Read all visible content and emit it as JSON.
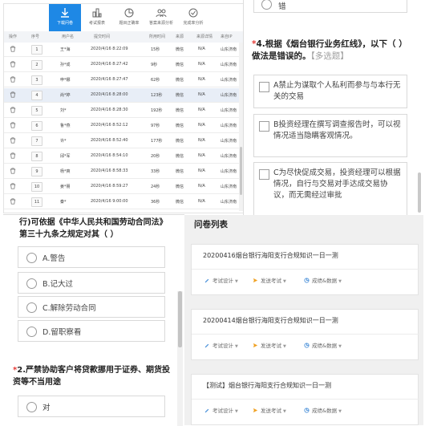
{
  "table_panel": {
    "toolbar": [
      {
        "label": "下载问卷",
        "icon": "download-icon",
        "active": true
      },
      {
        "label": "考试报表",
        "icon": "report-icon",
        "active": false
      },
      {
        "label": "题目正确率",
        "icon": "pie-chart-icon",
        "active": false
      },
      {
        "label": "答案来源分析",
        "icon": "group-icon",
        "active": false
      },
      {
        "label": "完成率分析",
        "icon": "check-circle-icon",
        "active": false
      }
    ],
    "columns": [
      "操作",
      "序号",
      "用户名",
      "提交时间",
      "所用时间",
      "来源",
      "来源详情",
      "来自IP"
    ],
    "rows": [
      {
        "no": "1",
        "user": "王*海",
        "time": "2020/4/16 8:22:09",
        "dur": "15秒",
        "src": "微信",
        "detail": "N/A",
        "ip": "山东济南"
      },
      {
        "no": "2",
        "user": "孙*成",
        "time": "2020/4/16 8:27:42",
        "dur": "9秒",
        "src": "微信",
        "detail": "N/A",
        "ip": "山东济南"
      },
      {
        "no": "3",
        "user": "申*娜",
        "time": "2020/4/16 8:27:47",
        "dur": "62秒",
        "src": "微信",
        "detail": "N/A",
        "ip": "山东济南"
      },
      {
        "no": "4",
        "user": "尚*婷",
        "time": "2020/4/16 8:28:00",
        "dur": "123秒",
        "src": "微信",
        "detail": "N/A",
        "ip": "山东济南"
      },
      {
        "no": "5",
        "user": "刘*",
        "time": "2020/4/16 8:28:30",
        "dur": "192秒",
        "src": "微信",
        "detail": "N/A",
        "ip": "山东济南"
      },
      {
        "no": "6",
        "user": "鲁*燕",
        "time": "2020/4/16 8:52:12",
        "dur": "97秒",
        "src": "微信",
        "detail": "N/A",
        "ip": "山东济南"
      },
      {
        "no": "7",
        "user": "许*",
        "time": "2020/4/16 8:52:40",
        "dur": "177秒",
        "src": "微信",
        "detail": "N/A",
        "ip": "山东济南"
      },
      {
        "no": "8",
        "user": "邱*军",
        "time": "2020/4/16 8:54:10",
        "dur": "20秒",
        "src": "微信",
        "detail": "N/A",
        "ip": "山东济南"
      },
      {
        "no": "9",
        "user": "杨*爽",
        "time": "2020/4/16 8:58:33",
        "dur": "33秒",
        "src": "微信",
        "detail": "N/A",
        "ip": "山东济南"
      },
      {
        "no": "10",
        "user": "姜*朋",
        "time": "2020/4/16 8:59:27",
        "dur": "24秒",
        "src": "微信",
        "detail": "N/A",
        "ip": "山东济南"
      },
      {
        "no": "11",
        "user": "秦*",
        "time": "2020/4/16 9:00:00",
        "dur": "36秒",
        "src": "微信",
        "detail": "N/A",
        "ip": "山东济南"
      }
    ],
    "accent": "#1e88e5",
    "highlight_row": "#e8eef7"
  },
  "question4_panel": {
    "prev_option_tail": "错",
    "required_mark": "*",
    "title": "4.根据《烟台银行业务红线》，以下（ ）做法是错误的。",
    "type_tag": "【多选题】",
    "options": [
      "A禁止为谋取个人私利而参与与本行无关的交易",
      "B投资经理在撰写调查报告时，可以视情况适当隐瞒客观情况。",
      "C为尽快促成交易，投资经理可以根据情况，自行与交易对手达成交易协议，而无需经过审批"
    ],
    "required_color": "#e53935"
  },
  "question1_panel": {
    "question_text": "行)可依据《中华人民共和国劳动合同法》第三十九条之规定对其（ ）",
    "options": [
      "A.警告",
      "B.记大过",
      "C.解除劳动合同",
      "D.留职察看"
    ],
    "question2": {
      "required_mark": "*",
      "title": "2.严禁协助客户将贷款挪用于证券、期货投资等不当用途",
      "options": [
        "对"
      ]
    }
  },
  "list_panel": {
    "heading": "问卷列表",
    "cards": [
      {
        "name": "20200416烟台银行海阳支行合规知识一日一测"
      },
      {
        "name": "20200414烟台银行海阳支行合规知识一日一测"
      },
      {
        "name": "【测试】烟台银行海阳支行合规知识一日一测"
      }
    ],
    "actions": [
      {
        "label": "考试设计",
        "icon": "pencil-icon"
      },
      {
        "label": "发送考试",
        "icon": "send-icon"
      },
      {
        "label": "成绩&数据",
        "icon": "data-icon"
      }
    ],
    "background": "#f0f0f0"
  }
}
